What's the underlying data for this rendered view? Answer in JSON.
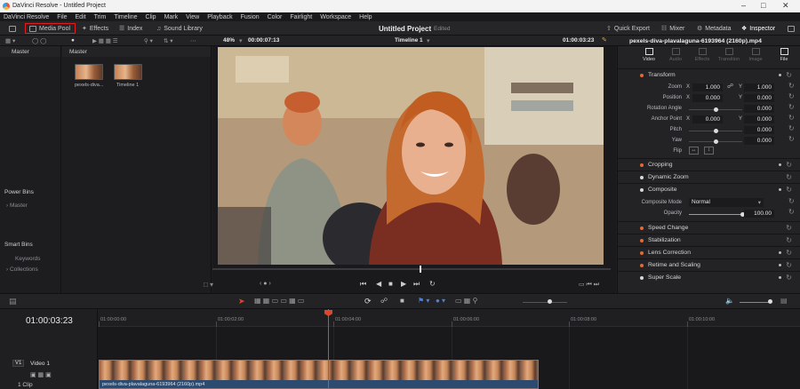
{
  "titlebar": {
    "title": "DaVinci Resolve - Untitled Project"
  },
  "menu": [
    "DaVinci Resolve",
    "File",
    "Edit",
    "Trim",
    "Timeline",
    "Clip",
    "Mark",
    "View",
    "Playback",
    "Fusion",
    "Color",
    "Fairlight",
    "Workspace",
    "Help"
  ],
  "toolbar": {
    "media_pool": "Media Pool",
    "effects": "Effects",
    "index": "Index",
    "sound_library": "Sound Library",
    "project_title": "Untitled Project",
    "project_status": "Edited",
    "quick_export": "Quick Export",
    "mixer": "Mixer",
    "metadata": "Metadata",
    "inspector": "Inspector"
  },
  "viewer": {
    "zoom": "48%",
    "source_tc": "00:00:07:13",
    "timeline_name": "Timeline 1",
    "record_tc": "01:00:03:23",
    "clip_name": "pexels-diva-plavalaguna-6193964 (2160p).mp4"
  },
  "bins": {
    "header": "Master",
    "power_bins": "Power Bins",
    "power_master": "Master",
    "smart_bins": "Smart Bins",
    "keywords": "Keywords",
    "collections": "Collections"
  },
  "pool": {
    "header": "Master",
    "items": [
      {
        "label": "pexels-diva..."
      },
      {
        "label": "Timeline 1"
      }
    ]
  },
  "inspector": {
    "tabs": [
      "Video",
      "Audio",
      "Effects",
      "Transition",
      "Image",
      "File"
    ],
    "transform": {
      "title": "Transform",
      "zoom_label": "Zoom",
      "zoom_x": "1.000",
      "zoom_y": "1.000",
      "position_label": "Position",
      "pos_x": "0.000",
      "pos_y": "0.000",
      "rotation_label": "Rotation Angle",
      "rotation": "0.000",
      "anchor_label": "Anchor Point",
      "anchor_x": "0.000",
      "anchor_y": "0.000",
      "pitch_label": "Pitch",
      "pitch": "0.000",
      "yaw_label": "Yaw",
      "yaw": "0.000",
      "flip_label": "Flip",
      "x": "X",
      "y": "Y"
    },
    "sections": [
      "Cropping",
      "Dynamic Zoom",
      "Composite",
      "Speed Change",
      "Stabilization",
      "Lens Correction",
      "Retime and Scaling",
      "Super Scale"
    ],
    "composite": {
      "mode_label": "Composite Mode",
      "mode_value": "Normal",
      "opacity_label": "Opacity",
      "opacity": "100.00"
    }
  },
  "timeline": {
    "timecode": "01:00:03:23",
    "ruler": [
      "01:00:00:00",
      "01:00:02:00",
      "01:00:04:00",
      "01:00:06:00",
      "01:00:08:00",
      "01:00:10:00"
    ],
    "track_id": "V1",
    "track_name": "Video 1",
    "clip_count": "1 Clip",
    "clip_name": "pexels-diva-plavalaguna-6193964 (2160p).mp4"
  },
  "colors": {
    "accent": "#e0452a",
    "highlight_box": "#e01e1e",
    "clip": "#2c4b6f"
  }
}
